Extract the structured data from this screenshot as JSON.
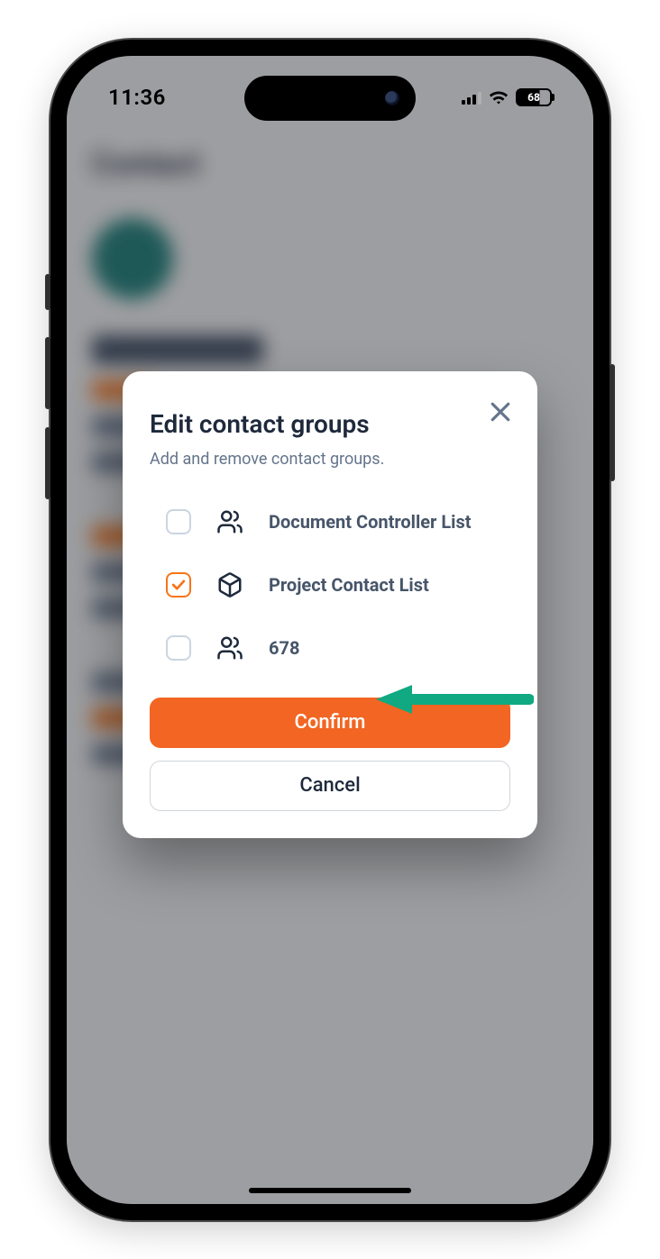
{
  "status": {
    "time": "11:36",
    "battery": "68"
  },
  "background": {
    "title": "Contact"
  },
  "modal": {
    "title": "Edit contact groups",
    "subtitle": "Add and remove contact groups.",
    "items": [
      {
        "label": "Document Controller List",
        "checked": false,
        "icon": "people"
      },
      {
        "label": "Project Contact List",
        "checked": true,
        "icon": "cube"
      },
      {
        "label": "678",
        "checked": false,
        "icon": "people"
      }
    ],
    "confirm": "Confirm",
    "cancel": "Cancel"
  }
}
